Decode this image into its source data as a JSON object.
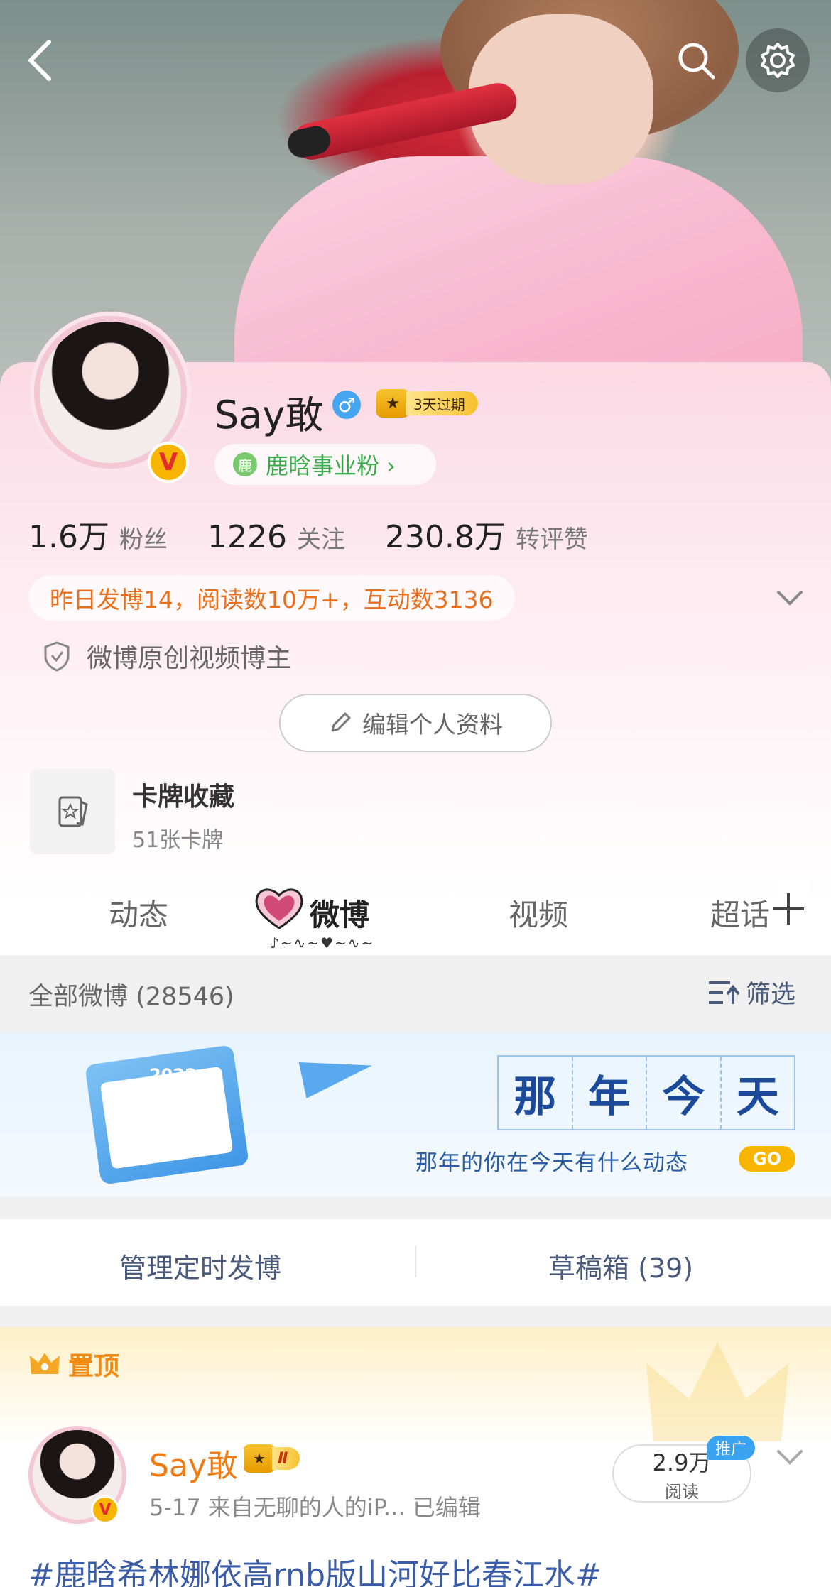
{
  "header": {
    "back_icon": "back-arrow-icon",
    "search_icon": "search-icon",
    "settings_icon": "gear-icon"
  },
  "profile": {
    "name": "Say敢",
    "gender_symbol": "♂",
    "vip_label": "3天过期",
    "fan_group": "鹿晗事业粉 ›",
    "verified_badge": "V",
    "stats": [
      {
        "value": "1.6万",
        "label": "粉丝"
      },
      {
        "value": "1226",
        "label": "关注"
      },
      {
        "value": "230.8万",
        "label": "转评赞"
      }
    ],
    "brief": "昨日发博14，阅读数10万+，互动数3136",
    "certification": "微博原创视频博主",
    "edit_button": "编辑个人资料"
  },
  "card_collection": {
    "title": "卡牌收藏",
    "subtitle": "51张卡牌"
  },
  "tabs": [
    {
      "label": "动态"
    },
    {
      "label": "微博"
    },
    {
      "label": "视频"
    },
    {
      "label": "超话"
    }
  ],
  "feed_header": {
    "all_posts": "全部微博 (28546)",
    "filter": "筛选"
  },
  "banner": {
    "title_chars": [
      "那",
      "年",
      "今",
      "天"
    ],
    "subtitle": "那年的你在今天有什么动态",
    "go": "GO",
    "calendar_year": "2022"
  },
  "manage": {
    "scheduled": "管理定时发博",
    "drafts": "草稿箱 (39)"
  },
  "pinned_post": {
    "tag": "置顶",
    "author": "Say敢",
    "level": "Ⅱ",
    "meta": "5-17  来自无聊的人的iP...  已编辑",
    "reads_value": "2.9万",
    "reads_label": "阅读",
    "promo": "推广",
    "text": "#鹿晗希林娜依高rnb版山河好比春江水#"
  },
  "colors": {
    "accent_orange": "#f07b12",
    "link_blue": "#3b5da8",
    "vip_gold": "#f7b500",
    "fan_green": "#3aaa4a"
  }
}
